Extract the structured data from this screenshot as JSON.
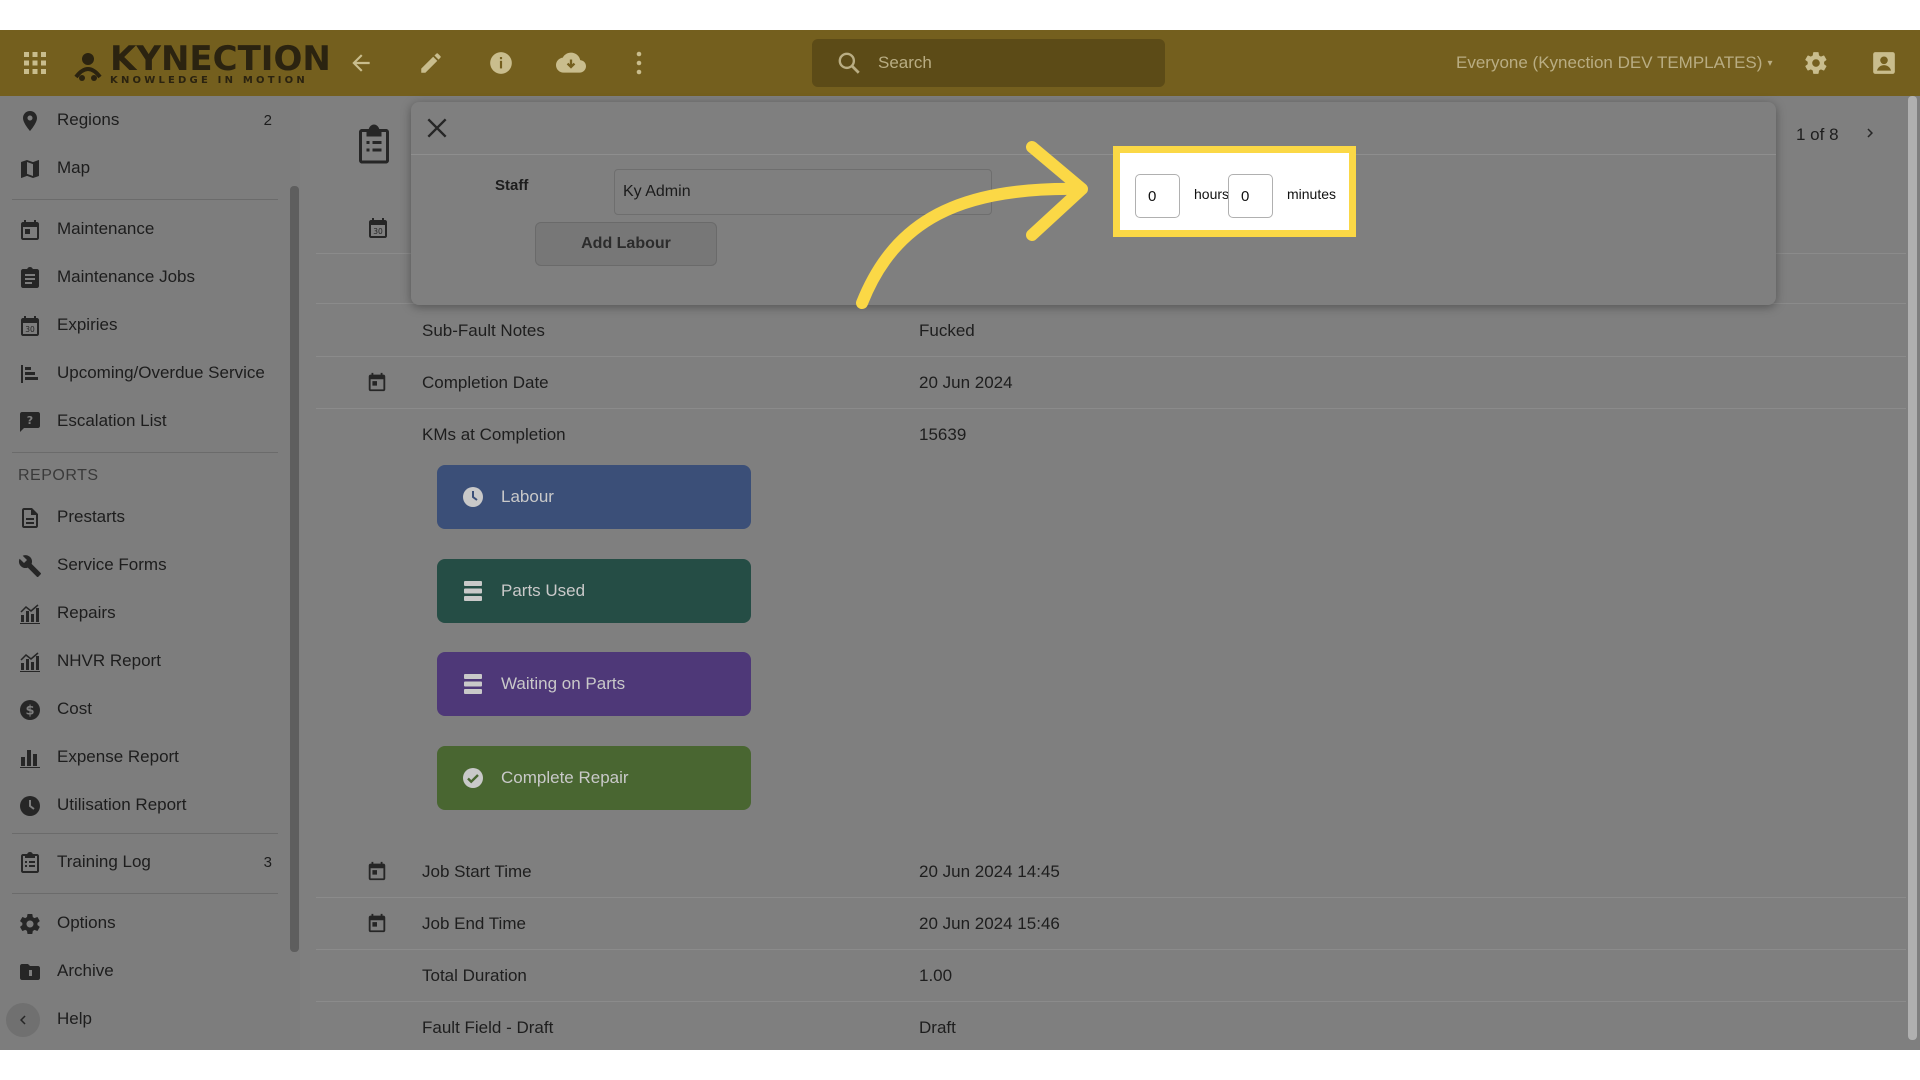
{
  "topbar": {
    "logo_text": "KYNECTION",
    "logo_tagline": "KNOWLEDGE IN MOTION",
    "search_placeholder": "Search",
    "scope_label": "Everyone (Kynection DEV TEMPLATES)",
    "icons": [
      "apps-grid-icon",
      "back-arrow-icon",
      "pencil-icon",
      "info-icon",
      "cloud-download-icon",
      "more-vert-icon",
      "search-icon",
      "gear-icon",
      "account-icon"
    ]
  },
  "sidebar": {
    "items_top": [
      {
        "label": "Regions",
        "count": "2",
        "icon": "location-pin-icon"
      },
      {
        "label": "Map",
        "icon": "map-icon"
      }
    ],
    "items_maint": [
      {
        "label": "Maintenance",
        "icon": "calendar-icon"
      },
      {
        "label": "Maintenance Jobs",
        "icon": "clipboard-icon"
      },
      {
        "label": "Expiries",
        "icon": "calendar-30-icon"
      },
      {
        "label": "Upcoming/Overdue Service",
        "icon": "timeline-icon"
      },
      {
        "label": "Escalation List",
        "icon": "question-bubble-icon"
      }
    ],
    "reports_heading": "REPORTS",
    "items_reports": [
      {
        "label": "Prestarts",
        "icon": "document-icon"
      },
      {
        "label": "Service Forms",
        "icon": "wrench-icon"
      },
      {
        "label": "Repairs",
        "icon": "bar-chart-icon"
      },
      {
        "label": "NHVR Report",
        "icon": "bar-chart-icon"
      },
      {
        "label": "Cost",
        "icon": "dollar-icon"
      },
      {
        "label": "Expense Report",
        "icon": "bar-chart-icon"
      },
      {
        "label": "Utilisation Report",
        "icon": "clock-icon"
      }
    ],
    "items_bottom": [
      {
        "label": "Training Log",
        "count": "3",
        "icon": "clipboard-icon"
      },
      {
        "label": "Options",
        "icon": "gear-icon"
      },
      {
        "label": "Archive",
        "icon": "archive-icon"
      },
      {
        "label": "Help",
        "icon": "chevron-left-icon"
      }
    ]
  },
  "pager": {
    "text": "1 of 8"
  },
  "modal": {
    "staff_label": "Staff",
    "staff_value": "Ky Admin",
    "add_button": "Add Labour",
    "hours_value": "0",
    "hours_unit": "hours",
    "minutes_value": "0",
    "minutes_unit": "minutes"
  },
  "details_top": [
    {
      "label": "Sub-Fault Notes",
      "value": "Fucked",
      "cal": false
    },
    {
      "label": "Completion Date",
      "value": "20 Jun 2024",
      "cal": true
    },
    {
      "label": "KMs at Completion",
      "value": "15639",
      "cal": false
    }
  ],
  "actions": [
    {
      "label": "Labour",
      "icon": "clock-icon",
      "color": "#3b4f78"
    },
    {
      "label": "Parts Used",
      "icon": "list-icon",
      "color": "#254d45"
    },
    {
      "label": "Waiting on Parts",
      "icon": "list-icon",
      "color": "#4e3878"
    },
    {
      "label": "Complete Repair",
      "icon": "check-circle-icon",
      "color": "#496631"
    }
  ],
  "details_bottom": [
    {
      "label": "Job Start Time",
      "value": "20 Jun 2024 14:45",
      "cal": true
    },
    {
      "label": "Job End Time",
      "value": "20 Jun 2024 15:46",
      "cal": true
    },
    {
      "label": "Total Duration",
      "value": "1.00",
      "cal": false
    },
    {
      "label": "Fault Field - Draft",
      "value": "Draft",
      "cal": false
    }
  ],
  "colors": {
    "accent": "#fbd846",
    "topbar": "#745f1e",
    "overlay": "#7f7f7f"
  }
}
